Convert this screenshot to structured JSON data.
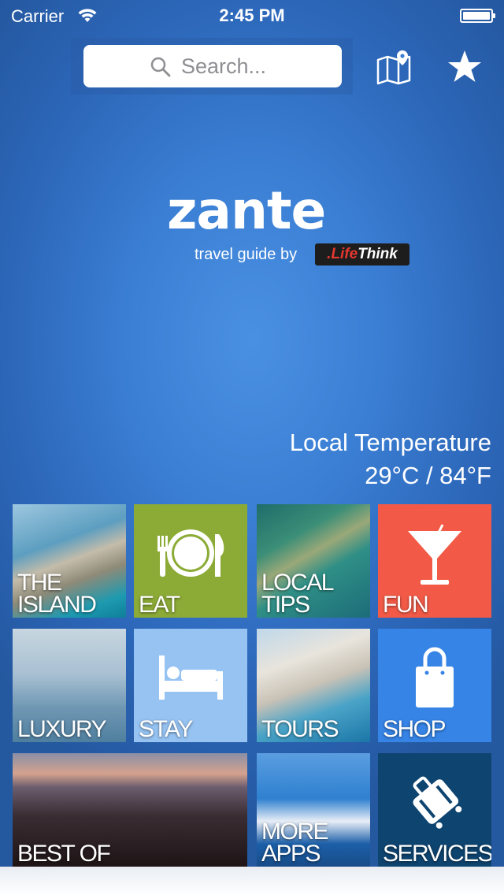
{
  "status_bar": {
    "carrier": "Carrier",
    "time": "2:45 PM"
  },
  "search": {
    "placeholder": "Search..."
  },
  "toolbar": {
    "map_icon": "map-pin-icon",
    "favorites_icon": "star-icon"
  },
  "brand": {
    "name": "zante",
    "tagline": "travel guide by",
    "publisher_prefix": ".Life",
    "publisher_suffix": "Think"
  },
  "weather": {
    "label": "Local Temperature",
    "value": "29°C / 84°F"
  },
  "tiles": [
    {
      "label_line1": "THE",
      "label_line2": "ISLAND",
      "color": "#2c7da6"
    },
    {
      "label_line1": "",
      "label_line2": "EAT",
      "color": "#8cab36",
      "icon": "plate-cutlery-icon"
    },
    {
      "label_line1": "",
      "label_line2": "LOCAL TIPS",
      "color": "#2e7f7a"
    },
    {
      "label_line1": "",
      "label_line2": "FUN",
      "color": "#f25a47",
      "icon": "cocktail-icon"
    },
    {
      "label_line1": "",
      "label_line2": "LUXURY",
      "color": "#7da7c4"
    },
    {
      "label_line1": "",
      "label_line2": "STAY",
      "color": "#96c3f2",
      "icon": "bed-icon"
    },
    {
      "label_line1": "",
      "label_line2": "TOURS",
      "color": "#2d6fa0"
    },
    {
      "label_line1": "",
      "label_line2": "SHOP",
      "color": "#3684e6",
      "icon": "shopping-bag-icon"
    },
    {
      "label_line1": "",
      "label_line2": "BEST OF",
      "color": "#4a3a45"
    },
    {
      "label_line1": "MORE",
      "label_line2": "APPS",
      "color": "#1b6fc4"
    },
    {
      "label_line1": "",
      "label_line2": "SERVICES",
      "color": "#0e4470",
      "icon": "luggage-icon"
    }
  ]
}
